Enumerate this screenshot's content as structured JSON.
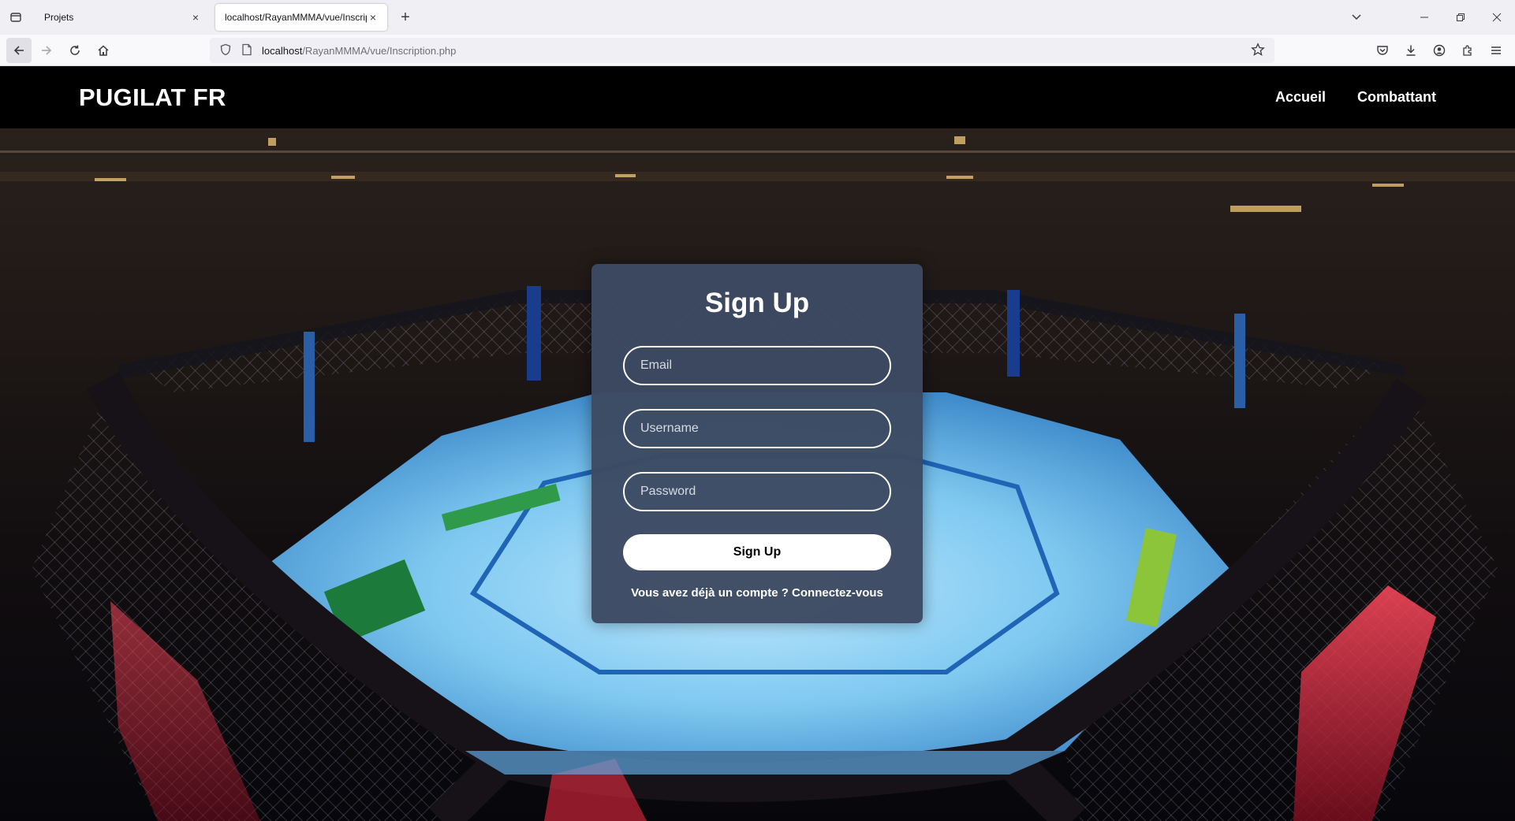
{
  "browser": {
    "tabs": [
      {
        "title": "Projets",
        "active": false
      },
      {
        "title": "localhost/RayanMMMA/vue/Inscrip",
        "active": true
      }
    ],
    "url": {
      "host": "localhost",
      "path": "/RayanMMMA/vue/Inscription.php"
    },
    "new_tab_label": "+",
    "close_glyph": "×"
  },
  "site": {
    "logo": "PUGILAT FR",
    "nav": [
      {
        "label": "Accueil"
      },
      {
        "label": "Combattant"
      }
    ]
  },
  "signup": {
    "title": "Sign Up",
    "email_placeholder": "Email",
    "username_placeholder": "Username",
    "password_placeholder": "Password",
    "submit_label": "Sign Up",
    "login_prompt": "Vous avez déjà un compte ?",
    "login_link": "Connectez-vous"
  },
  "colors": {
    "header_bg": "#000000",
    "card_bg": "#3d4a62",
    "accent_red": "#e8203a",
    "mat_blue": "#7ec8f0"
  }
}
